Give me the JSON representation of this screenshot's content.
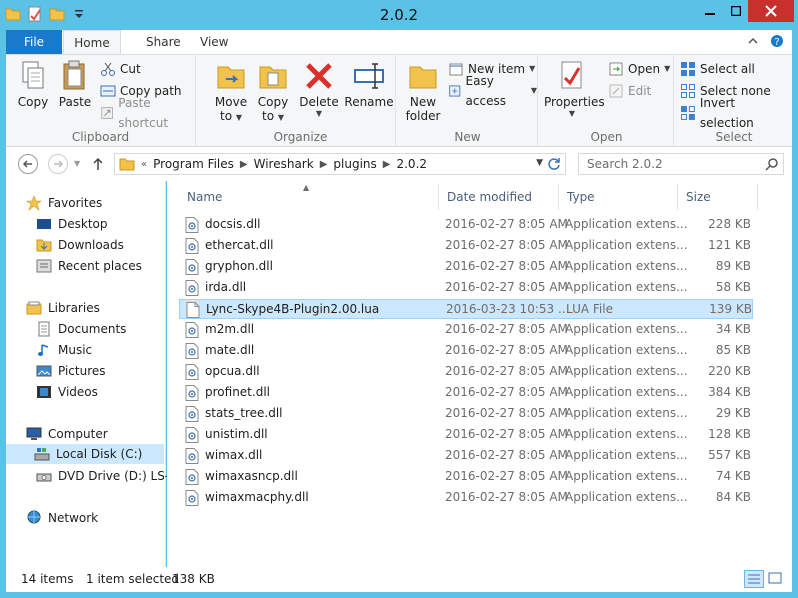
{
  "window": {
    "title": "2.0.2"
  },
  "tabs": {
    "file": "File",
    "home": "Home",
    "share": "Share",
    "view": "View"
  },
  "ribbon": {
    "clipboard": {
      "label": "Clipboard",
      "copy": "Copy",
      "paste": "Paste",
      "cut": "Cut",
      "copy_path": "Copy path",
      "paste_shortcut": "Paste shortcut"
    },
    "organize": {
      "label": "Organize",
      "move_to_1": "Move",
      "move_to_2": "to",
      "copy_to_1": "Copy",
      "copy_to_2": "to",
      "delete": "Delete",
      "rename": "Rename"
    },
    "new": {
      "label": "New",
      "new_folder_1": "New",
      "new_folder_2": "folder",
      "new_item": "New item",
      "easy_access": "Easy access"
    },
    "open": {
      "label": "Open",
      "properties": "Properties",
      "open": "Open",
      "edit": "Edit"
    },
    "select": {
      "label": "Select",
      "select_all": "Select all",
      "select_none": "Select none",
      "invert_selection": "Invert selection"
    }
  },
  "address": {
    "prefix": "«",
    "crumbs": [
      "Program Files",
      "Wireshark",
      "plugins",
      "2.0.2"
    ],
    "search_placeholder": "Search 2.0.2"
  },
  "nav": {
    "favorites": "Favorites",
    "desktop": "Desktop",
    "downloads": "Downloads",
    "recent": "Recent places",
    "libraries": "Libraries",
    "documents": "Documents",
    "music": "Music",
    "pictures": "Pictures",
    "videos": "Videos",
    "computer": "Computer",
    "local_disk": "Local Disk (C:)",
    "dvd": "DVD Drive (D:) LS-V-",
    "network": "Network"
  },
  "columns": {
    "name": "Name",
    "date": "Date modified",
    "type": "Type",
    "size": "Size"
  },
  "files": [
    {
      "name": "docsis.dll",
      "date": "2016-02-27 8:05 AM",
      "type": "Application extens...",
      "size": "228 KB",
      "kind": "dll"
    },
    {
      "name": "ethercat.dll",
      "date": "2016-02-27 8:05 AM",
      "type": "Application extens...",
      "size": "121 KB",
      "kind": "dll"
    },
    {
      "name": "gryphon.dll",
      "date": "2016-02-27 8:05 AM",
      "type": "Application extens...",
      "size": "89 KB",
      "kind": "dll"
    },
    {
      "name": "irda.dll",
      "date": "2016-02-27 8:05 AM",
      "type": "Application extens...",
      "size": "58 KB",
      "kind": "dll"
    },
    {
      "name": "Lync-Skype4B-Plugin2.00.lua",
      "date": "2016-03-23 10:53 ...",
      "type": "LUA File",
      "size": "139 KB",
      "kind": "lua",
      "selected": true
    },
    {
      "name": "m2m.dll",
      "date": "2016-02-27 8:05 AM",
      "type": "Application extens...",
      "size": "34 KB",
      "kind": "dll"
    },
    {
      "name": "mate.dll",
      "date": "2016-02-27 8:05 AM",
      "type": "Application extens...",
      "size": "85 KB",
      "kind": "dll"
    },
    {
      "name": "opcua.dll",
      "date": "2016-02-27 8:05 AM",
      "type": "Application extens...",
      "size": "220 KB",
      "kind": "dll"
    },
    {
      "name": "profinet.dll",
      "date": "2016-02-27 8:05 AM",
      "type": "Application extens...",
      "size": "384 KB",
      "kind": "dll"
    },
    {
      "name": "stats_tree.dll",
      "date": "2016-02-27 8:05 AM",
      "type": "Application extens...",
      "size": "29 KB",
      "kind": "dll"
    },
    {
      "name": "unistim.dll",
      "date": "2016-02-27 8:05 AM",
      "type": "Application extens...",
      "size": "128 KB",
      "kind": "dll"
    },
    {
      "name": "wimax.dll",
      "date": "2016-02-27 8:05 AM",
      "type": "Application extens...",
      "size": "557 KB",
      "kind": "dll"
    },
    {
      "name": "wimaxasncp.dll",
      "date": "2016-02-27 8:05 AM",
      "type": "Application extens...",
      "size": "74 KB",
      "kind": "dll"
    },
    {
      "name": "wimaxmacphy.dll",
      "date": "2016-02-27 8:05 AM",
      "type": "Application extens...",
      "size": "84 KB",
      "kind": "dll"
    }
  ],
  "status": {
    "count": "14 items",
    "selected": "1 item selected",
    "selected_size": "138 KB"
  },
  "colors": {
    "frame": "#5cc1e6",
    "file_tab": "#1979ca",
    "selection": "#cce8ff",
    "close": "#c7302c"
  }
}
